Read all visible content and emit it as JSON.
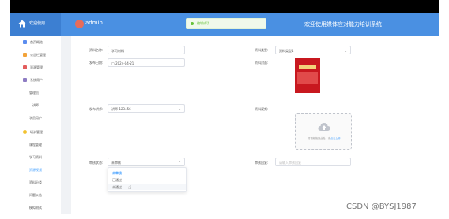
{
  "header": {
    "home_label": "欢迎使用",
    "admin_name": "admin",
    "welcome": "欢迎使用媒体应对能力培训系统",
    "toast": "编辑成功"
  },
  "sidebar": {
    "items": [
      {
        "label": "首页概览"
      },
      {
        "label": "公告栏管理"
      },
      {
        "label": "资源管理"
      },
      {
        "label": "系统用户"
      },
      {
        "label": "管理员"
      },
      {
        "label": "讲师"
      },
      {
        "label": "学员用户"
      },
      {
        "label": "培训管理"
      },
      {
        "label": "课程管理"
      },
      {
        "label": "学习资料"
      },
      {
        "label": "资源视频"
      },
      {
        "label": "资料分类"
      },
      {
        "label": "问题公告"
      },
      {
        "label": "模拟测试"
      }
    ]
  },
  "form": {
    "name_label": "资料名称:",
    "name_value": "学习材料",
    "type_label": "资料类型:",
    "type_value": "资料类型1",
    "date_label": "发布日期:",
    "date_value": "2024-04-21",
    "cover_label": "资料封面:",
    "teacher_label": "发布讲师:",
    "teacher_value": "讲师-123456",
    "video_label": "资料视频:",
    "upload_text": "将视频拖到此处，或",
    "upload_link": "点击上传",
    "review_status_label": "审核状态:",
    "review_status_value": "未审核",
    "review_reply_label": "审核回复:",
    "review_reply_placeholder": "请输入审核回复"
  },
  "dropdown": {
    "options": [
      {
        "label": "未审核",
        "selected": true
      },
      {
        "label": "已通过",
        "selected": false
      },
      {
        "label": "未通过",
        "selected": false
      }
    ]
  },
  "watermark": "CSDN @BYSJ1987",
  "colors": {
    "header": "#4a90e2",
    "accent": "#409eff",
    "toast_text": "#67c23a"
  }
}
